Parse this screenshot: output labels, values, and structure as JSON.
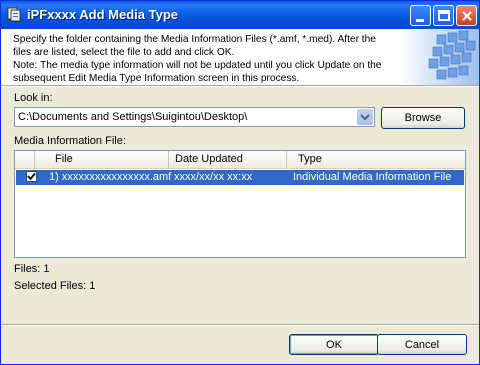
{
  "window": {
    "title": "iPFxxxx Add Media Type"
  },
  "description": {
    "lines": [
      "Specify the folder containing the Media Information Files (*.amf, *.med). After the",
      "files are listed, select the file to add and click OK.",
      "Note: The media type information will not be updated until you click Update on the",
      "subsequent Edit Media Type Information screen in this process."
    ]
  },
  "look_in": {
    "label": "Look in:",
    "value": "C:\\Documents and Settings\\Suigintou\\Desktop\\",
    "browse_label": "Browse"
  },
  "media_list": {
    "label": "Media Information File:",
    "columns": [
      "File",
      "Date Updated",
      "Type"
    ],
    "rows": [
      {
        "checked": true,
        "file": "1) xxxxxxxxxxxxxxxx.amf",
        "date": "xxxx/xx/xx xx:xx",
        "type": "Individual Media Information File"
      }
    ]
  },
  "status": {
    "files": "Files: 1",
    "selected": "Selected Files: 1"
  },
  "buttons": {
    "ok": "OK",
    "cancel": "Cancel"
  },
  "colors": {
    "titlebar": "#0a5fe3",
    "selection": "#316ac5",
    "dialog_bg": "#ece9d8"
  }
}
